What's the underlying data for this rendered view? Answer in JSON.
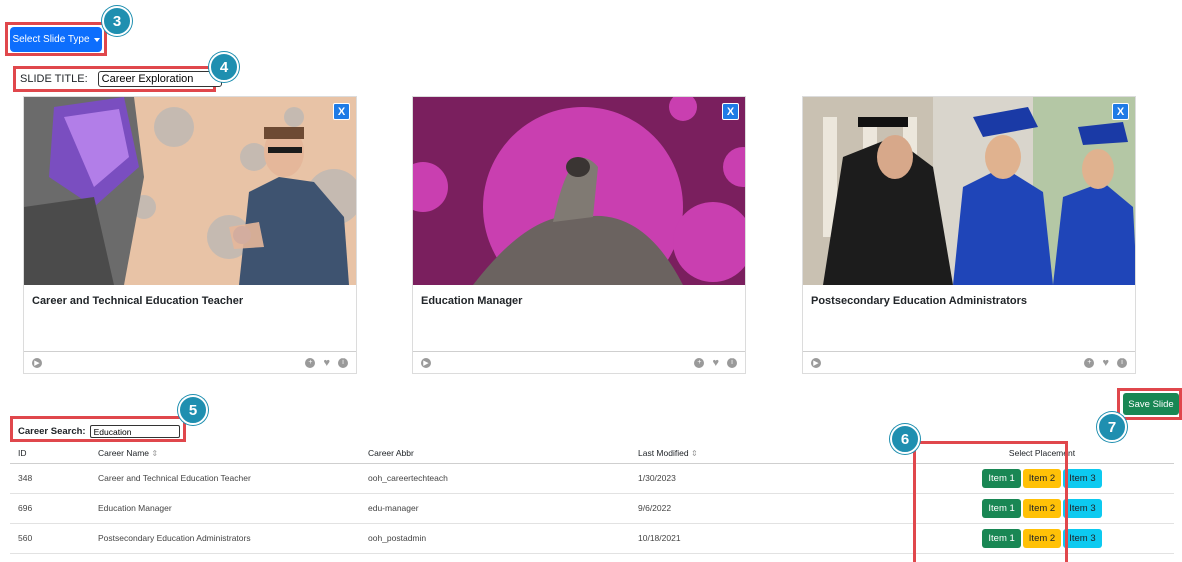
{
  "header": {
    "select_slide_type_label": "Select Slide Type"
  },
  "slide_title": {
    "label": "SLIDE TITLE:",
    "value": "Career Exploration"
  },
  "cards": [
    {
      "title": "Career and Technical Education Teacher",
      "close": "X"
    },
    {
      "title": "Education Manager",
      "close": "X"
    },
    {
      "title": "Postsecondary Education Administrators",
      "close": "X"
    }
  ],
  "save_label": "Save Slide",
  "search": {
    "label": "Career Search:",
    "value": "Education"
  },
  "table": {
    "headers": [
      "ID",
      "Career Name",
      "Career Abbr",
      "Last Modified",
      "Select Placement"
    ],
    "rows": [
      {
        "id": "348",
        "name": "Career and Technical Education Teacher",
        "abbr": "ooh_careertechteach",
        "modified": "1/30/2023"
      },
      {
        "id": "696",
        "name": "Education Manager",
        "abbr": "edu-manager",
        "modified": "9/6/2022"
      },
      {
        "id": "560",
        "name": "Postsecondary Education Administrators",
        "abbr": "ooh_postadmin",
        "modified": "10/18/2021"
      }
    ],
    "placement": [
      "Item 1",
      "Item 2",
      "Item 3"
    ]
  },
  "callouts": [
    "3",
    "4",
    "5",
    "6",
    "7"
  ],
  "colors": {
    "primary": "#0d6efd",
    "success": "#198754",
    "warning": "#ffc107",
    "info": "#0dcaf0",
    "callout": "#1f8fb0",
    "highlight": "#e0474c"
  }
}
